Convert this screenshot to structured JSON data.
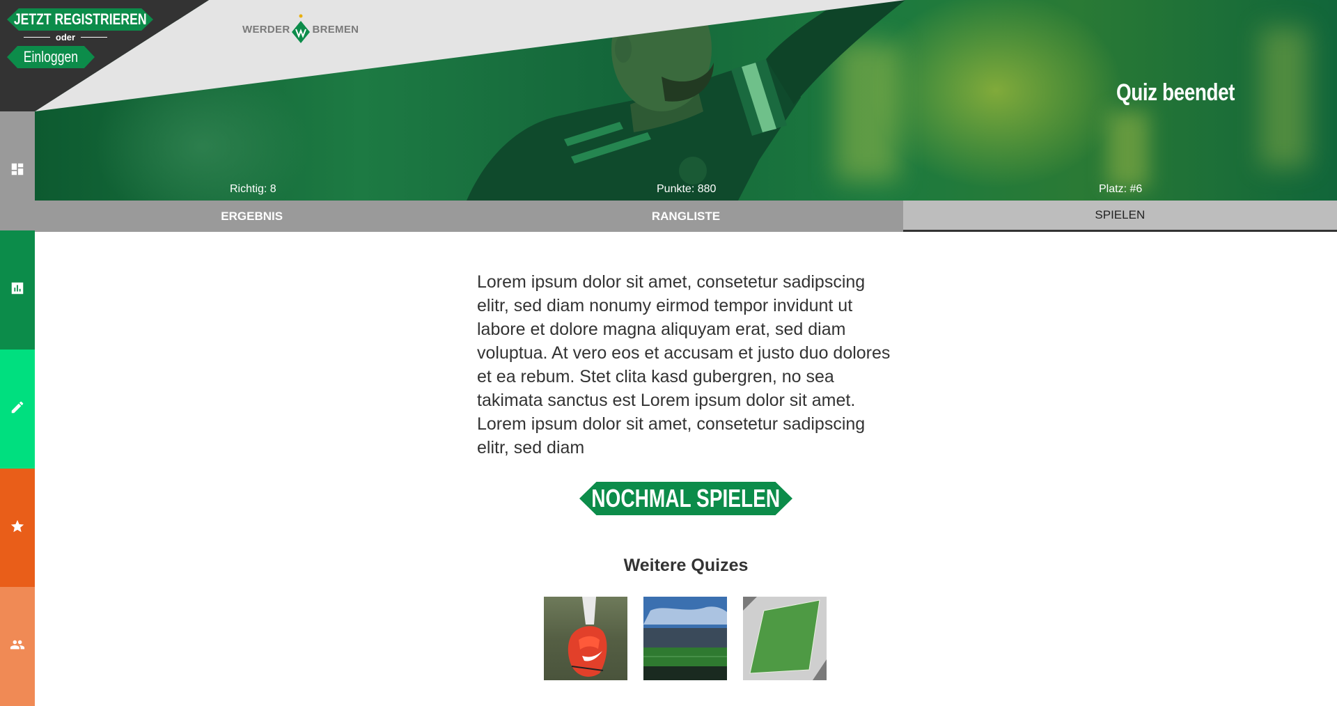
{
  "auth": {
    "register_label": "JETZT REGISTRIEREN",
    "or_label": "oder",
    "login_label": "Einloggen"
  },
  "brand": {
    "name_left": "WERDER",
    "name_right": "BREMEN",
    "color_primary": "#0c8c4a"
  },
  "hero": {
    "title": "Quiz beendet",
    "stats": {
      "correct": "Richtig: 8",
      "points": "Punkte: 880",
      "rank": "Platz: #6"
    }
  },
  "tabs": [
    {
      "label": "ERGEBNIS",
      "active": false
    },
    {
      "label": "RANGLISTE",
      "active": false
    },
    {
      "label": "SPIELEN",
      "active": true
    }
  ],
  "sidebar": {
    "items": [
      {
        "icon": "dashboard-icon",
        "color": "#9a9a9a"
      },
      {
        "icon": "chart-icon",
        "color": "#0c8c4a"
      },
      {
        "icon": "pencil-icon",
        "color": "#00df7f"
      },
      {
        "icon": "star-icon",
        "color": "#e95e19"
      },
      {
        "icon": "people-icon",
        "color": "#f08a55"
      }
    ]
  },
  "main": {
    "text": "Lorem ipsum dolor sit amet, consetetur sadipscing elitr, sed diam nonumy eirmod tempor invidunt ut labore et dolore magna aliquyam erat, sed diam voluptua. At vero eos et accusam et justo duo dolores et ea rebum. Stet clita kasd gubergren, no sea takimata sanctus est Lorem ipsum dolor sit amet. Lorem ipsum dolor sit amet, consetetur sadipscing elitr, sed diam",
    "play_again_label": "NOCHMAL SPIELEN",
    "more_quizzes_title": "Weitere Quizes"
  }
}
